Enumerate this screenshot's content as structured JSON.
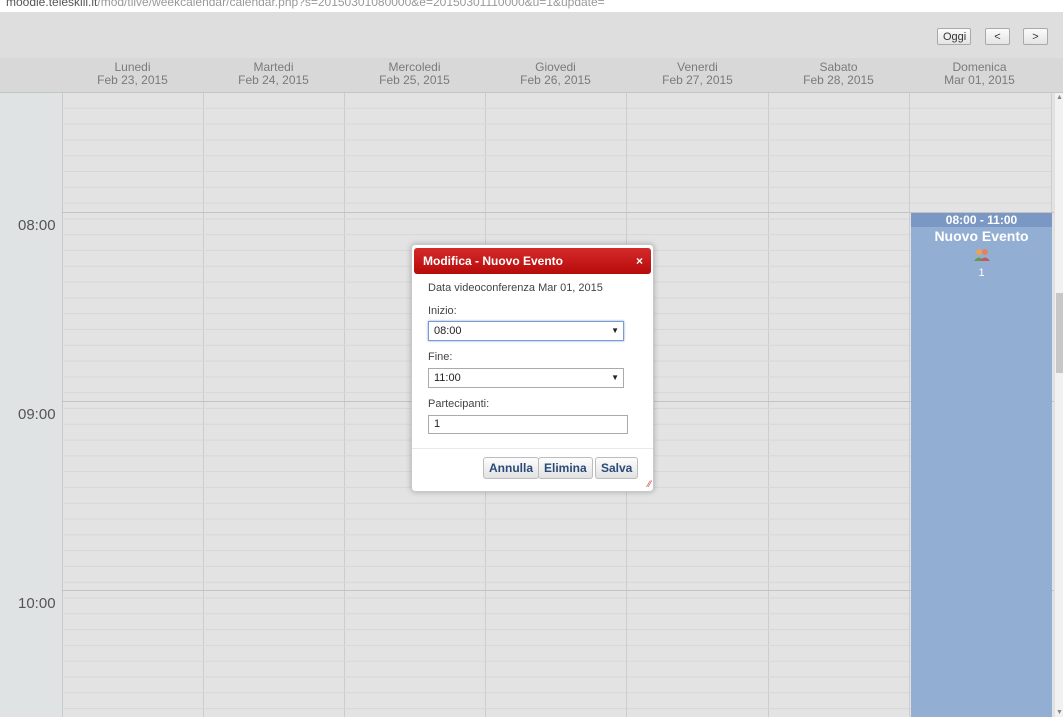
{
  "url": {
    "domain": "moodle.teleskill.it",
    "path": "/mod/tlive/weekcalendar/calendar.php?s=20150301080000&e=20150301110000&u=1&update="
  },
  "toolbar": {
    "today_label": "Oggi",
    "prev_label": "<",
    "next_label": ">"
  },
  "days": [
    {
      "name": "Lunedi",
      "date": "Feb 23, 2015"
    },
    {
      "name": "Martedi",
      "date": "Feb 24, 2015"
    },
    {
      "name": "Mercoledi",
      "date": "Feb 25, 2015"
    },
    {
      "name": "Giovedi",
      "date": "Feb 26, 2015"
    },
    {
      "name": "Venerdi",
      "date": "Feb 27, 2015"
    },
    {
      "name": "Sabato",
      "date": "Feb 28, 2015"
    },
    {
      "name": "Domenica",
      "date": "Mar 01, 2015"
    }
  ],
  "hours": [
    "08:00",
    "09:00",
    "10:00"
  ],
  "event": {
    "time": "08:00 - 11:00",
    "title": "Nuovo Evento",
    "icon": "participants-icon",
    "participants": "1",
    "color": "#93aed3"
  },
  "dialog": {
    "title": "Modifica - Nuovo Evento",
    "close": "×",
    "date_line": "Data videoconferenza Mar 01, 2015",
    "start_label": "Inizio:",
    "start_value": "08:00",
    "end_label": "Fine:",
    "end_value": "11:00",
    "participants_label": "Partecipanti:",
    "participants_value": "1",
    "cancel_label": "Annulla",
    "delete_label": "Elimina",
    "save_label": "Salva",
    "accent": "#c41212"
  }
}
